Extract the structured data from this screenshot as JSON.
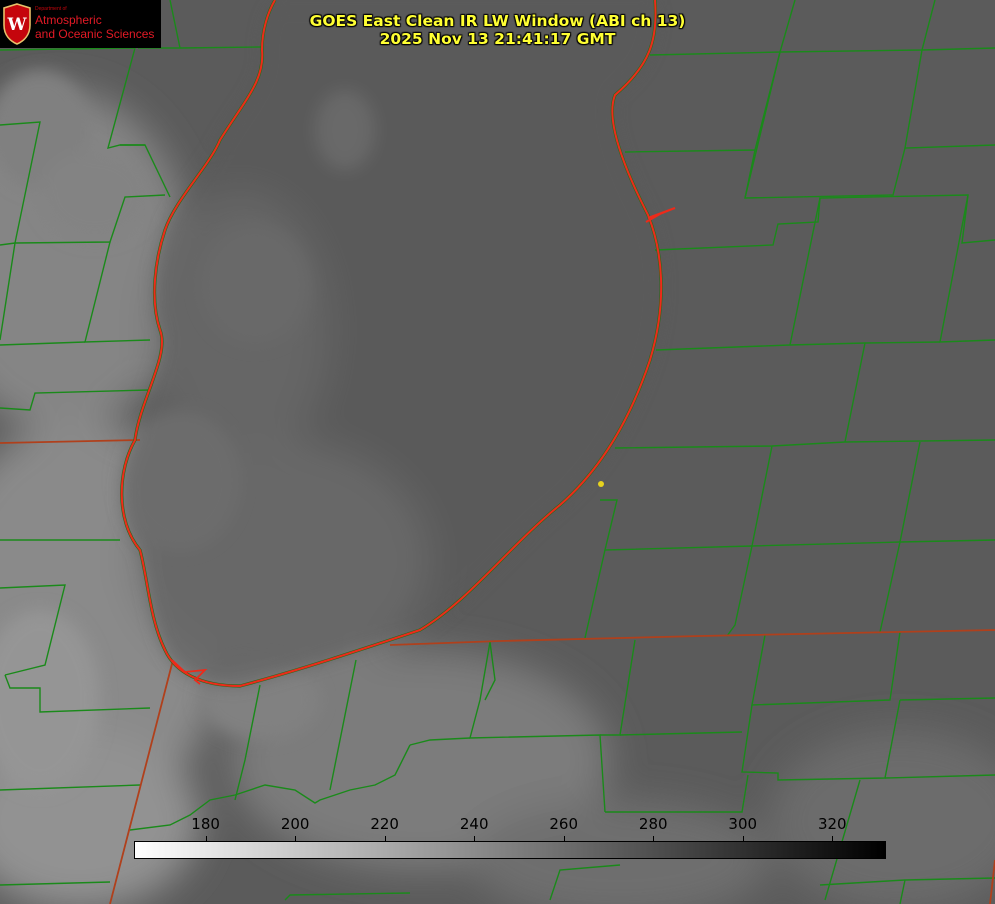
{
  "title": {
    "line1": "GOES East Clean IR LW Window (ABI ch 13)",
    "line2": "2025 Nov 13 21:41:17 GMT"
  },
  "logo": {
    "department_label": "Department of",
    "name_line1": "Atmospheric",
    "name_line2": "and Oceanic Sciences",
    "crest_letter": "W",
    "icon": "uw-crest-icon"
  },
  "colorbar": {
    "ticks": [
      "180",
      "200",
      "220",
      "240",
      "260",
      "280",
      "300",
      "320"
    ],
    "tick_values": [
      180,
      200,
      220,
      240,
      260,
      280,
      300,
      320
    ],
    "min_value": 164,
    "max_value": 332,
    "colors": [
      "#ffffff",
      "#000000"
    ]
  },
  "colors": {
    "background_gray": "#5e5e5e",
    "cloud_light_gray": "#8a8a8a",
    "county_lines": "#1a8a1a",
    "state_lines": "#b0401c",
    "lake_shoreline": "#ee2a1a",
    "title_text": "#ffff33",
    "marker": "#e6d21e"
  },
  "map": {
    "features": [
      "lake-michigan-shoreline",
      "county-boundaries",
      "state-boundaries",
      "cloud-field",
      "location-marker"
    ]
  }
}
